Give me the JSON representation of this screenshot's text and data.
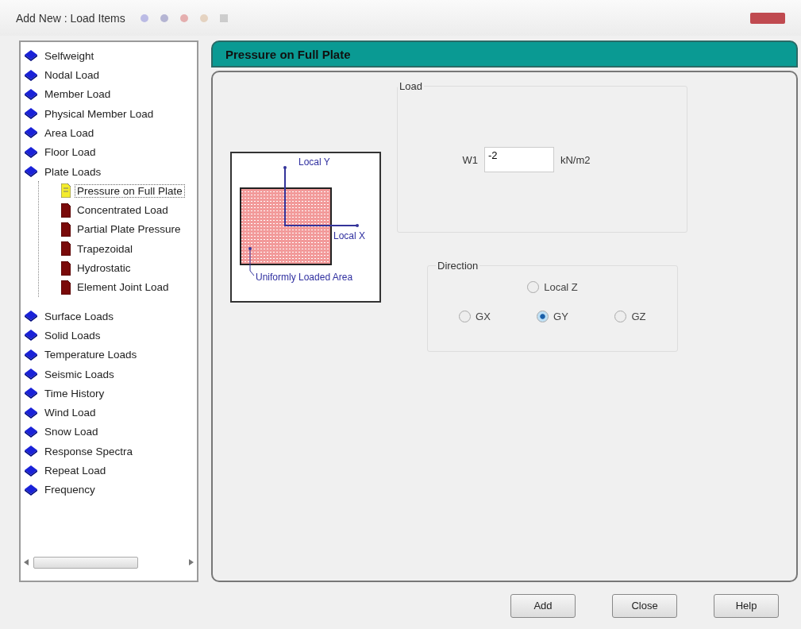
{
  "window": {
    "title": "Add New : Load Items"
  },
  "tree": [
    {
      "label": "Selfweight",
      "kind": "book",
      "selected": false
    },
    {
      "label": "Nodal Load",
      "kind": "book",
      "selected": false
    },
    {
      "label": "Member Load",
      "kind": "book",
      "selected": false
    },
    {
      "label": "Physical Member Load",
      "kind": "book",
      "selected": false
    },
    {
      "label": "Area Load",
      "kind": "book",
      "selected": false
    },
    {
      "label": "Floor Load",
      "kind": "book",
      "selected": false
    },
    {
      "label": "Plate Loads",
      "kind": "book",
      "selected": false,
      "expanded": true,
      "children": [
        {
          "label": "Pressure on Full Plate",
          "kind": "page",
          "selected": true
        },
        {
          "label": "Concentrated Load",
          "kind": "page",
          "selected": false
        },
        {
          "label": "Partial Plate Pressure",
          "kind": "page",
          "selected": false
        },
        {
          "label": "Trapezoidal",
          "kind": "page",
          "selected": false
        },
        {
          "label": "Hydrostatic",
          "kind": "page",
          "selected": false
        },
        {
          "label": "Element Joint Load",
          "kind": "page",
          "selected": false
        }
      ]
    },
    {
      "label": "Surface Loads",
      "kind": "book",
      "selected": false
    },
    {
      "label": "Solid Loads",
      "kind": "book",
      "selected": false
    },
    {
      "label": "Temperature Loads",
      "kind": "book",
      "selected": false
    },
    {
      "label": "Seismic Loads",
      "kind": "book",
      "selected": false
    },
    {
      "label": "Time History",
      "kind": "book",
      "selected": false
    },
    {
      "label": "Wind Load",
      "kind": "book",
      "selected": false
    },
    {
      "label": "Snow Load",
      "kind": "book",
      "selected": false
    },
    {
      "label": "Response Spectra",
      "kind": "book",
      "selected": false
    },
    {
      "label": "Repeat Load",
      "kind": "book",
      "selected": false
    },
    {
      "label": "Frequency",
      "kind": "book",
      "selected": false
    }
  ],
  "panel": {
    "title": "Pressure on Full Plate",
    "diagram": {
      "y_label": "Local Y",
      "x_label": "Local X",
      "area_label": "Uniformly Loaded Area"
    },
    "load": {
      "legend": "Load",
      "label": "W1",
      "value": "-2",
      "unit": "kN/m2"
    },
    "direction": {
      "legend": "Direction",
      "options": [
        {
          "label": "Local Z",
          "selected": false
        },
        {
          "label": "GX",
          "selected": false
        },
        {
          "label": "GY",
          "selected": true
        },
        {
          "label": "GZ",
          "selected": false
        }
      ]
    }
  },
  "buttons": [
    "Add",
    "Close",
    "Help"
  ]
}
